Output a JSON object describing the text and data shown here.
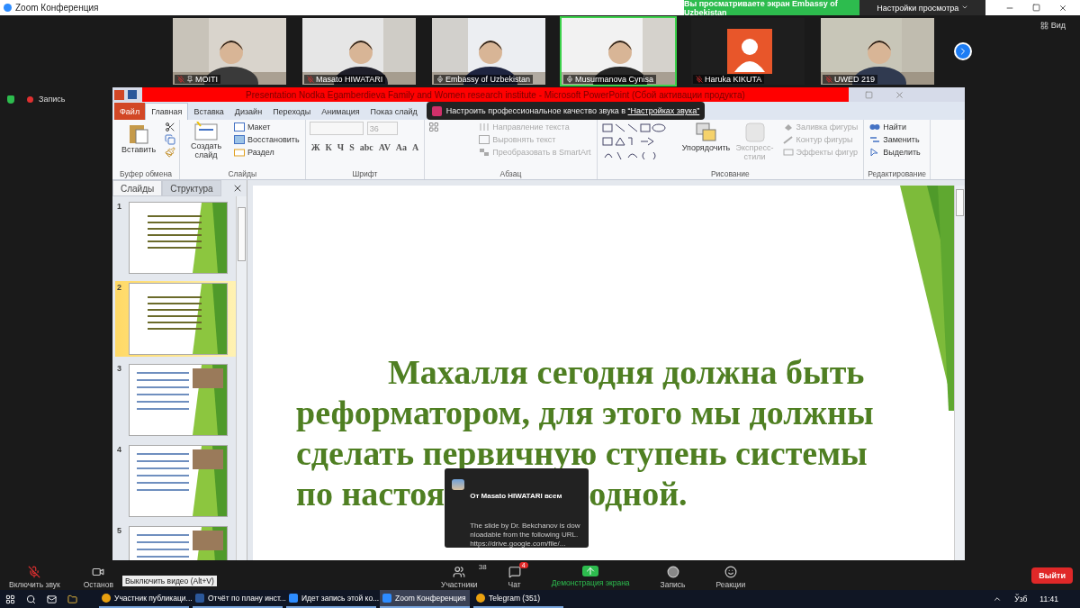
{
  "app_title": "Zoom Конференция",
  "share_banner": "Вы просматриваете экран Embassy of Uzbekistan",
  "view_settings": "Настройки просмотра",
  "participants": [
    {
      "name": "MOITI",
      "kind": "picture",
      "muted": true,
      "pinned": true,
      "active": false
    },
    {
      "name": "Masato HIWATARI",
      "kind": "picture",
      "muted": true,
      "pinned": false,
      "active": false
    },
    {
      "name": "Embassy of Uzbekistan",
      "kind": "picture",
      "muted": false,
      "pinned": false,
      "active": false
    },
    {
      "name": "Musurmanova Cynisa",
      "kind": "picture",
      "muted": false,
      "pinned": false,
      "active": true
    },
    {
      "name": "Haruka KIKUTA",
      "kind": "avatar",
      "muted": true,
      "pinned": false,
      "active": false
    },
    {
      "name": "UWED 219",
      "kind": "picture",
      "muted": true,
      "pinned": false,
      "active": false
    }
  ],
  "view_button": "Вид",
  "recording_label": "Запись",
  "ppt": {
    "title": "Presentation Nodka Egamberdieva  Family and Women research institute  -  Microsoft PowerPoint (Сбой активации продукта)",
    "tabs": [
      {
        "label": "Файл",
        "kind": "file",
        "selected": false
      },
      {
        "label": "Главная",
        "kind": "tab",
        "selected": true
      },
      {
        "label": "Вставка",
        "kind": "tab",
        "selected": false
      },
      {
        "label": "Дизайн",
        "kind": "tab",
        "selected": false
      },
      {
        "label": "Переходы",
        "kind": "tab",
        "selected": false
      },
      {
        "label": "Анимация",
        "kind": "tab",
        "selected": false
      },
      {
        "label": "Показ слайд",
        "kind": "tab",
        "selected": false
      }
    ],
    "groups": [
      {
        "label": "Буфер обмена",
        "kind": "clipboard",
        "items": [
          {
            "label": "Вставить",
            "disabled": false
          }
        ]
      },
      {
        "label": "Слайды",
        "kind": "slides",
        "items": [
          {
            "label": "Создать слайд",
            "disabled": false
          },
          {
            "label": "Макет",
            "disabled": false
          },
          {
            "label": "Восстановить",
            "disabled": false
          },
          {
            "label": "Раздел",
            "disabled": false
          }
        ]
      },
      {
        "label": "Шрифт",
        "kind": "font",
        "font_size": "36",
        "format_buttons": [
          "Ж",
          "К",
          "Ч",
          "S",
          "abc",
          "AV",
          "Aa",
          "A"
        ]
      },
      {
        "label": "Абзац",
        "kind": "paragraph",
        "items": [
          {
            "label": "Направление текста",
            "disabled": true
          },
          {
            "label": "Выровнять текст",
            "disabled": true
          },
          {
            "label": "Преобразовать в SmartArt",
            "disabled": true
          }
        ]
      },
      {
        "label": "Рисование",
        "kind": "drawing",
        "items": [
          {
            "label": "Упорядочить",
            "disabled": false
          },
          {
            "label": "Экспресс-стили",
            "disabled": true
          },
          {
            "label": "Заливка фигуры",
            "disabled": true
          },
          {
            "label": "Контур фигуры",
            "disabled": true
          },
          {
            "label": "Эффекты фигур",
            "disabled": true
          }
        ]
      },
      {
        "label": "Редактирование",
        "kind": "editing",
        "items": [
          {
            "label": "Найти",
            "disabled": false
          },
          {
            "label": "Заменить",
            "disabled": false
          },
          {
            "label": "Выделить",
            "disabled": false
          }
        ]
      }
    ],
    "notification": {
      "text": "Настроить профессиональное качество звука в ",
      "link": "“Настройках звука”"
    },
    "pane_tabs": [
      {
        "label": "Слайды",
        "selected": true
      },
      {
        "label": "Структура",
        "selected": false
      }
    ],
    "thumbnails": [
      {
        "number": "1",
        "selected": false
      },
      {
        "number": "2",
        "selected": true
      },
      {
        "number": "3",
        "selected": false
      },
      {
        "number": "4",
        "selected": false
      },
      {
        "number": "5",
        "selected": false
      }
    ],
    "slide": {
      "lines": [
        "Махалля сегодня должна быть",
        "реформатором, для этого мы должны",
        "сделать первичную ступень системы"
      ],
      "last_line_start": "по настоя",
      "last_line_end": "одной."
    }
  },
  "chat_popup": {
    "sender": "От Masato HIWATARI всем",
    "message": "The slide by Dr. Bekchanov is downloadable from the following URL.https://drive.google.com/file/..."
  },
  "toolbar": [
    {
      "label": "Включить звук",
      "kind": "mute"
    },
    {
      "label": "Останов",
      "kind": "video",
      "tooltip": "Выключить видео (Alt+V)"
    },
    {
      "label": "Участники",
      "kind": "participants",
      "count": "38"
    },
    {
      "label": "Чат",
      "kind": "chat",
      "badge": "4"
    },
    {
      "label": "Демонстрация экрана",
      "kind": "share"
    },
    {
      "label": "Запись",
      "kind": "record"
    },
    {
      "label": "Реакции",
      "kind": "reactions"
    }
  ],
  "leave_button": "Выйти",
  "taskbar": {
    "apps": [
      {
        "label": "Участник публикаци...",
        "kind": "chrome",
        "selected": false
      },
      {
        "label": "Отчёт по плану инст...",
        "kind": "word",
        "selected": false
      },
      {
        "label": "Идет запись этой ко...",
        "kind": "zoom",
        "selected": false
      },
      {
        "label": "Zoom Конференция",
        "kind": "zoom",
        "selected": true
      },
      {
        "label": "Telegram (351)",
        "kind": "chrome",
        "selected": false
      }
    ],
    "language": "Ўзб",
    "time": "11:41"
  }
}
